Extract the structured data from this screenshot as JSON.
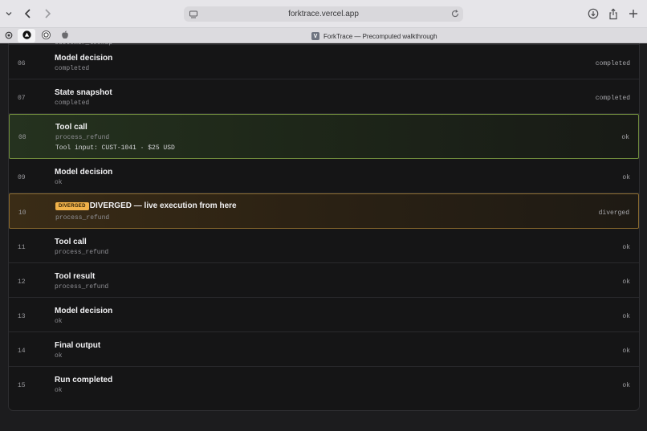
{
  "browser": {
    "url": "forktrace.vercel.app",
    "tab_title": "ForkTrace — Precomputed walkthrough",
    "tab_favicon_letter": "V"
  },
  "cut_row_label": "customer_lookup",
  "badge_text": "DIVERGED",
  "rows": [
    {
      "idx": "06",
      "title": "Model decision",
      "sub": "completed",
      "status": "completed"
    },
    {
      "idx": "07",
      "title": "State snapshot",
      "sub": "completed",
      "status": "completed"
    },
    {
      "idx": "08",
      "title": "Tool call",
      "sub": "process_refund",
      "extra": "Tool input: CUST-1041 · $25 USD",
      "status": "ok"
    },
    {
      "idx": "09",
      "title": "Model decision",
      "sub": "ok",
      "status": "ok"
    },
    {
      "idx": "10",
      "title": "DIVERGED — live execution from here",
      "sub": "process_refund",
      "status": "diverged"
    },
    {
      "idx": "11",
      "title": "Tool call",
      "sub": "process_refund",
      "status": "ok"
    },
    {
      "idx": "12",
      "title": "Tool result",
      "sub": "process_refund",
      "status": "ok"
    },
    {
      "idx": "13",
      "title": "Model decision",
      "sub": "ok",
      "status": "ok"
    },
    {
      "idx": "14",
      "title": "Final output",
      "sub": "ok",
      "status": "ok"
    },
    {
      "idx": "15",
      "title": "Run completed",
      "sub": "ok",
      "status": "ok"
    }
  ]
}
